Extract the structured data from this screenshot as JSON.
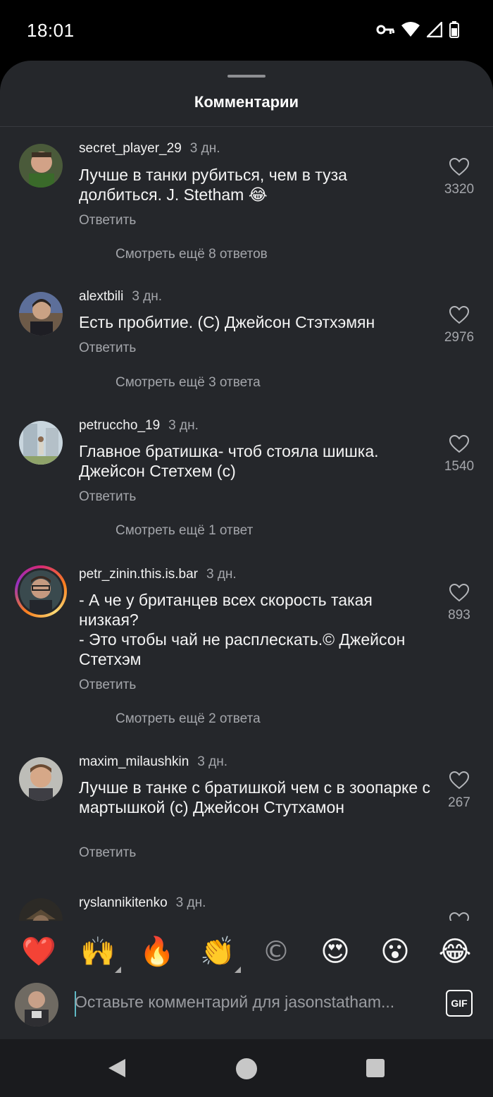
{
  "status_bar": {
    "time": "18:01",
    "icons": [
      "vpn-key-icon",
      "wifi-icon",
      "cell-signal-icon",
      "battery-icon"
    ]
  },
  "sheet": {
    "title": "Комментарии"
  },
  "comments": [
    {
      "username": "secret_player_29",
      "time": "3 дн.",
      "text": "Лучше в танки рубиться, чем в туза долбиться. J. Stetham 😂",
      "reply": "Ответить",
      "likes": "3320",
      "more": "Смотреть ещё 8 ответов"
    },
    {
      "username": "alextbili",
      "time": "3 дн.",
      "text": "Есть пробитие. (С) Джейсон Стэтхэмян",
      "reply": "Ответить",
      "likes": "2976",
      "more": "Смотреть ещё 3 ответа"
    },
    {
      "username": "petruccho_19",
      "time": "3 дн.",
      "text": "Главное братишка- чтоб стояла шишка. Джейсон Стетхем (с)",
      "reply": "Ответить",
      "likes": "1540",
      "more": "Смотреть ещё 1 ответ"
    },
    {
      "username": "petr_zinin.this.is.bar",
      "time": "3 дн.",
      "text": "- А че у британцев всех скорость такая низкая?\n- Это чтобы чай не расплескать.© Джейсон Стетхэм",
      "reply": "Ответить",
      "likes": "893",
      "more": "Смотреть ещё 2 ответа",
      "has_story": true
    },
    {
      "username": "maxim_milaushkin",
      "time": "3 дн.",
      "text": "Лучше в танке с братишкой чем с в зоопарке с мартышкой (с) Джейсон Стутхамон",
      "reply": "Ответить",
      "likes": "267"
    },
    {
      "username": "ryslannikitenko",
      "time": "3 дн."
    }
  ],
  "emoji_bar": [
    {
      "name": "red-heart-emoji",
      "glyph": "❤️"
    },
    {
      "name": "raising-hands-emoji",
      "glyph": "🙌"
    },
    {
      "name": "fire-emoji",
      "glyph": "🔥"
    },
    {
      "name": "clapping-hands-emoji",
      "glyph": "👏"
    },
    {
      "name": "copyright-emoji",
      "glyph": "©"
    },
    {
      "name": "heart-eyes-emoji",
      "glyph": "😍"
    },
    {
      "name": "surprised-face-emoji",
      "glyph": "😮"
    },
    {
      "name": "tears-of-joy-emoji",
      "glyph": "😂"
    }
  ],
  "comment_input": {
    "placeholder": "Оставьте комментарий для jasonstatham...",
    "gif_label": "GIF"
  },
  "nav_bar": {
    "icons": [
      "back-icon",
      "home-icon",
      "recents-icon"
    ]
  }
}
